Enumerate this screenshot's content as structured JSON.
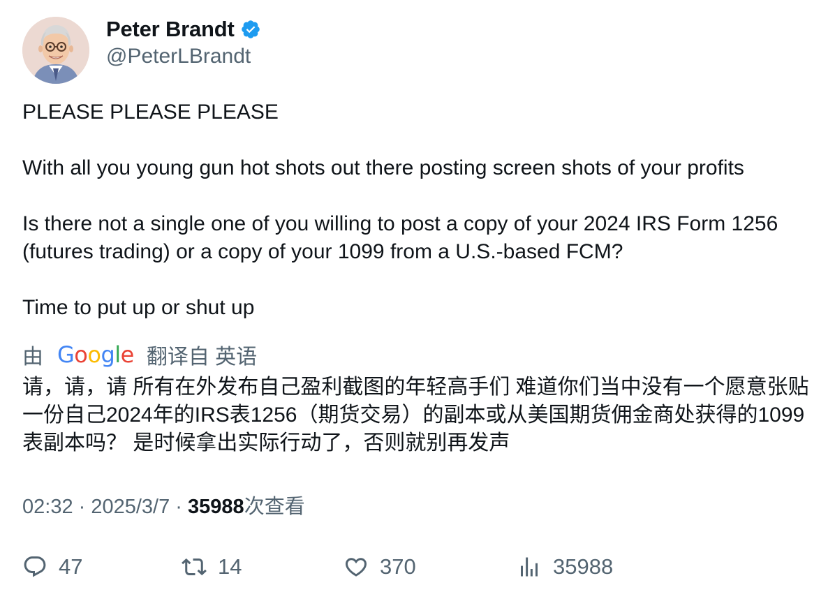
{
  "author": {
    "display_name": "Peter Brandt",
    "handle": "@PeterLBrandt",
    "verified_icon": "verified-badge-icon",
    "badge_color": "#1d9bf0"
  },
  "tweet": {
    "paragraphs": [
      "PLEASE PLEASE PLEASE",
      "With all you young gun hot shots out there posting screen shots of your profits",
      "Is there not a single one of you willing to post a copy of your 2024 IRS Form 1256 (futures trading) or a copy of your 1099 from a U.S.-based FCM?",
      "Time to put up or shut up"
    ]
  },
  "translation": {
    "prefix": "由",
    "provider": "Google",
    "suffix": "翻译自 英语",
    "text": "请，请，请 所有在外发布自己盈利截图的年轻高手们 难道你们当中没有一个愿意张贴一份自己2024年的IRS表1256（期货交易）的副本或从美国期货佣金商处获得的1099表副本吗？ 是时候拿出实际行动了，否则就别再发声"
  },
  "meta": {
    "time": "02:32",
    "sep1": " · ",
    "date": "2025/3/7",
    "sep2": " · ",
    "views": "35988",
    "views_label": "次查看"
  },
  "actions": {
    "reply": {
      "icon": "reply-icon",
      "count": "47"
    },
    "retweet": {
      "icon": "retweet-icon",
      "count": "14"
    },
    "like": {
      "icon": "heart-icon",
      "count": "370"
    },
    "views": {
      "icon": "views-chart-icon",
      "count": "35988"
    }
  },
  "colors": {
    "text": "#0f1419",
    "secondary": "#536471",
    "google_blue": "#4285f4",
    "google_red": "#ea4335",
    "google_yellow": "#fbbc05",
    "google_green": "#34a853"
  }
}
